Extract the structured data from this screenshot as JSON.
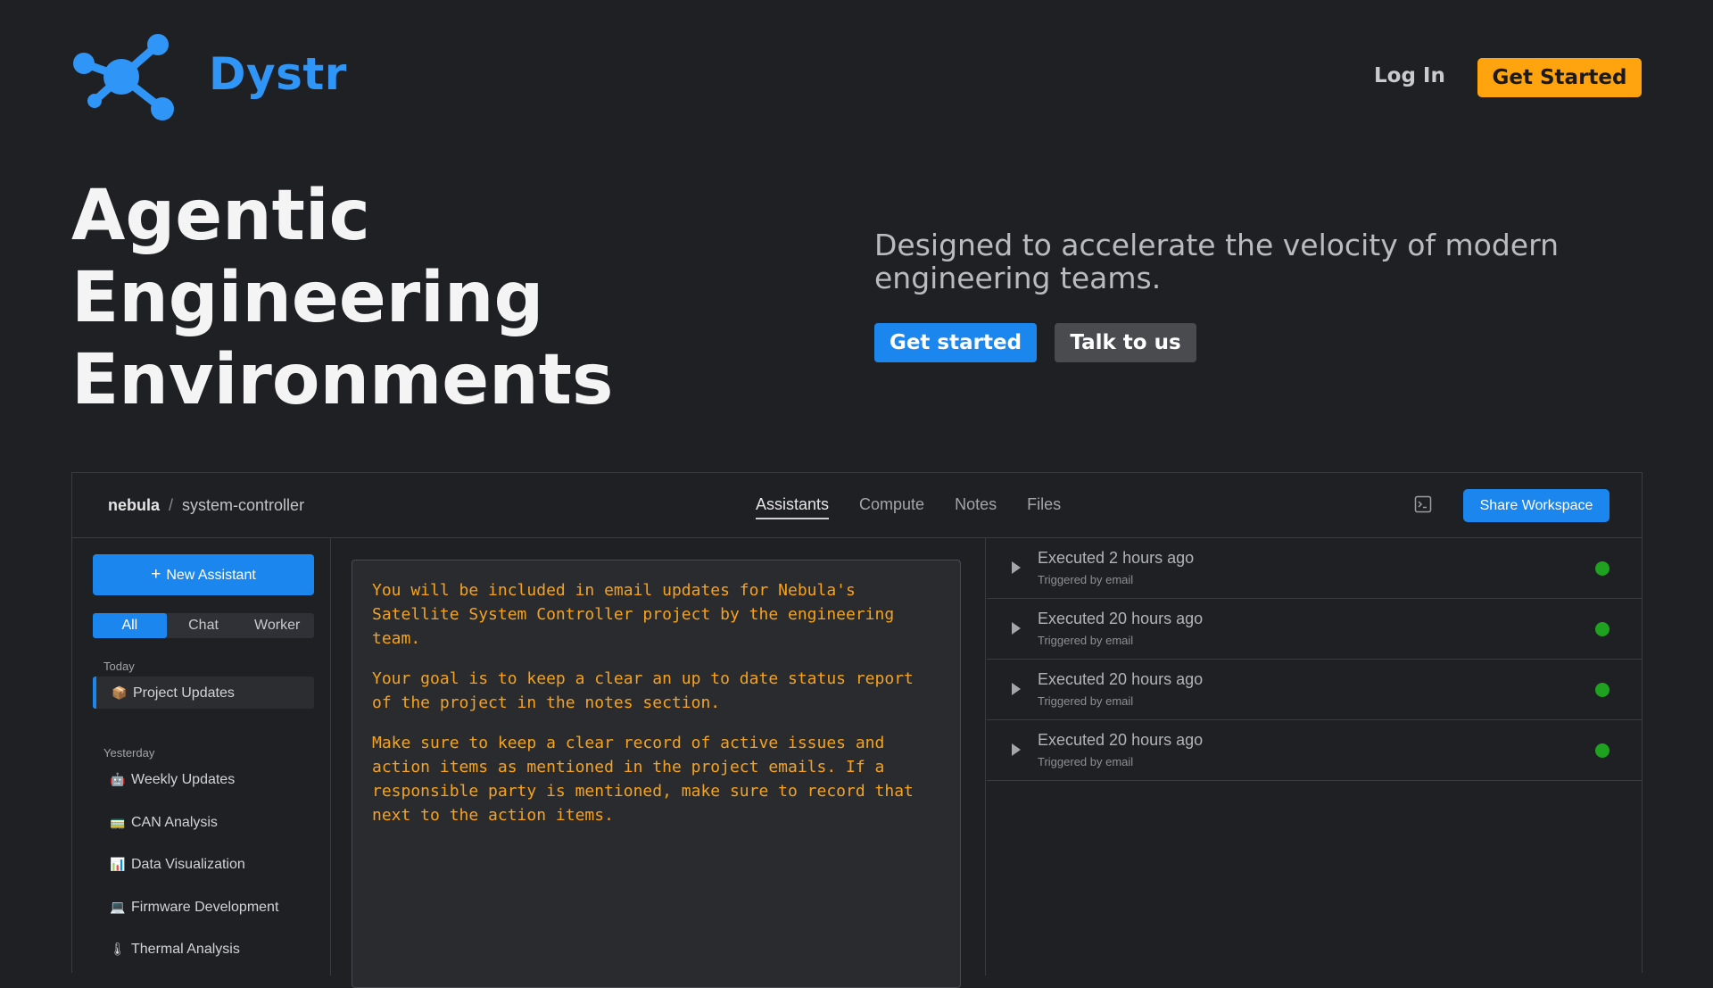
{
  "header": {
    "brand": "Dystr",
    "login_label": "Log In",
    "cta_label": "Get Started",
    "brand_color": "#2f95f6",
    "cta_color": "#ffa40f"
  },
  "hero": {
    "title_lines": [
      "Agentic",
      "Engineering",
      "Environments"
    ],
    "tagline": "Designed to accelerate the velocity of modern engineering teams.",
    "primary_label": "Get started",
    "secondary_label": "Talk to us"
  },
  "app": {
    "breadcrumb": {
      "project": "nebula",
      "separator": "/",
      "repo": "system-controller"
    },
    "tabs": [
      {
        "label": "Assistants",
        "active": true
      },
      {
        "label": "Compute",
        "active": false
      },
      {
        "label": "Notes",
        "active": false
      },
      {
        "label": "Files",
        "active": false
      }
    ],
    "terminal_icon": "terminal-icon",
    "share_label": "Share Workspace",
    "sidebar": {
      "new_label": "New Assistant",
      "filters": [
        {
          "label": "All",
          "active": true
        },
        {
          "label": "Chat",
          "active": false
        },
        {
          "label": "Worker",
          "active": false
        }
      ],
      "sections": [
        {
          "label": "Today",
          "items": [
            {
              "emoji": "📦",
              "label": "Project Updates",
              "selected": true
            }
          ]
        },
        {
          "label": "Yesterday",
          "items": [
            {
              "emoji": "🤖",
              "label": "Weekly Updates"
            },
            {
              "emoji": "🚃",
              "label": "CAN Analysis"
            },
            {
              "emoji": "📊",
              "label": "Data Visualization"
            },
            {
              "emoji": "💻",
              "label": "Firmware Development"
            },
            {
              "emoji": "🌡",
              "label": "Thermal Analysis"
            }
          ]
        }
      ]
    },
    "prompt": [
      "You will be included in email updates for Nebula's Satellite System Controller project by the engineering team.",
      "Your goal is to keep a clear an up to date status report of the project in the notes section.",
      "Make sure to keep a clear record of active issues and action items as mentioned in the project emails. If a responsible party is mentioned, make sure to record that next to the action items."
    ],
    "executions": [
      {
        "title": "Executed 2 hours ago",
        "trigger": "Triggered by email",
        "status_color": "#1fa21f"
      },
      {
        "title": "Executed 20 hours ago",
        "trigger": "Triggered by email",
        "status_color": "#1fa21f"
      },
      {
        "title": "Executed 20 hours ago",
        "trigger": "Triggered by email",
        "status_color": "#1fa21f"
      },
      {
        "title": "Executed 20 hours ago",
        "trigger": "Triggered by email",
        "status_color": "#1fa21f"
      }
    ]
  }
}
